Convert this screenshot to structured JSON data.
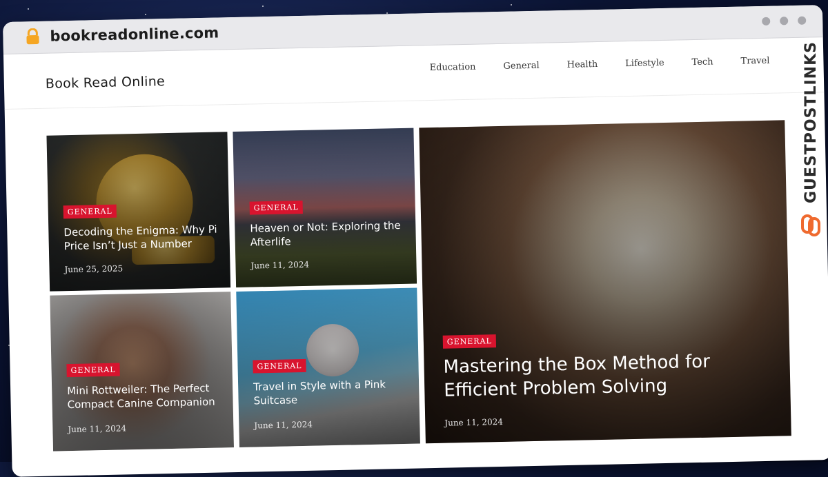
{
  "browser": {
    "url": "bookreadonline.com"
  },
  "site": {
    "title": "Book Read Online",
    "nav": [
      "Education",
      "General",
      "Health",
      "Lifestyle",
      "Tech",
      "Travel"
    ]
  },
  "posts": [
    {
      "category": "GENERAL",
      "title": "Decoding the Enigma: Why Pi Price Isn’t Just a Number",
      "date": "June 25, 2025"
    },
    {
      "category": "GENERAL",
      "title": "Heaven or Not: Exploring the Afterlife",
      "date": "June 11, 2024"
    },
    {
      "category": "GENERAL",
      "title": "Mastering the Box Method for Efficient Problem Solving",
      "date": "June 11, 2024"
    },
    {
      "category": "GENERAL",
      "title": "Mini Rottweiler: The Perfect Compact Canine Companion",
      "date": "June 11, 2024"
    },
    {
      "category": "GENERAL",
      "title": "Travel in Style with a Pink Suitcase",
      "date": "June 11, 2024"
    }
  ],
  "watermark": {
    "text": "GUESTPOSTLINKS",
    "icon": "chain-link-icon",
    "accent": "#ef6a2f"
  },
  "colors": {
    "badge": "#d8142e",
    "lock": "#f5a623"
  }
}
